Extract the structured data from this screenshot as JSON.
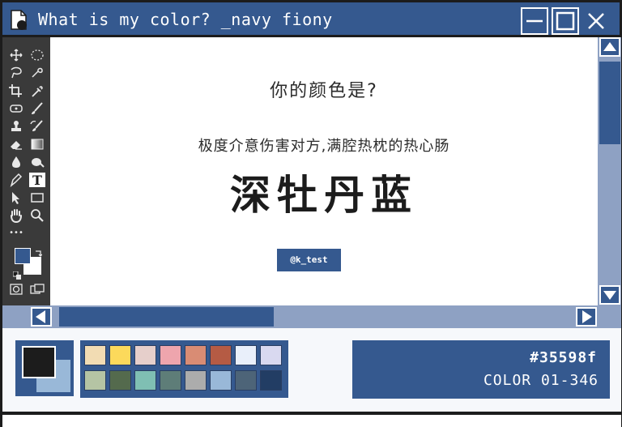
{
  "window": {
    "title": "What is my color? _navy fiony"
  },
  "toolbox": {
    "tools": [
      {
        "name": "move-icon"
      },
      {
        "name": "ellipse-select-icon"
      },
      {
        "name": "lasso-icon"
      },
      {
        "name": "quick-select-icon"
      },
      {
        "name": "crop-icon"
      },
      {
        "name": "eyedropper-icon"
      },
      {
        "name": "healing-icon"
      },
      {
        "name": "brush-icon"
      },
      {
        "name": "stamp-icon"
      },
      {
        "name": "history-brush-icon"
      },
      {
        "name": "eraser-icon"
      },
      {
        "name": "gradient-icon"
      },
      {
        "name": "blur-icon"
      },
      {
        "name": "dodge-icon"
      },
      {
        "name": "pen-icon"
      },
      {
        "name": "text-icon"
      },
      {
        "name": "path-select-icon"
      },
      {
        "name": "rectangle-icon"
      },
      {
        "name": "hand-icon"
      },
      {
        "name": "zoom-icon"
      }
    ],
    "text_tool_glyph": "T",
    "more_glyph": "•••",
    "foreground_color": "#35598f",
    "background_color": "#ffffff"
  },
  "canvas": {
    "question": "你的颜色是?",
    "description": "极度介意伤害对方,满腔热枕的热心肠",
    "color_name": "深牡丹蓝",
    "tag": "@k_test"
  },
  "bottom": {
    "foreground_swatch": "#1c1c1c",
    "background_swatch": "#99b8d8",
    "palette": [
      "#f2dcb3",
      "#fcd95b",
      "#e6cfcb",
      "#eea5ad",
      "#d98c74",
      "#b55b44",
      "#e9effa",
      "#d9d9f0",
      "#b5c4a4",
      "#546a4d",
      "#7fbfb3",
      "#5e7d78",
      "#acacac",
      "#99b8d8",
      "#4d6478",
      "#223d64"
    ],
    "hex": "#35598f",
    "code": "COLOR 01-346"
  },
  "colors": {
    "accent": "#35598f",
    "scroll_track": "#8ea1c3",
    "frame": "#1c1c1c"
  }
}
